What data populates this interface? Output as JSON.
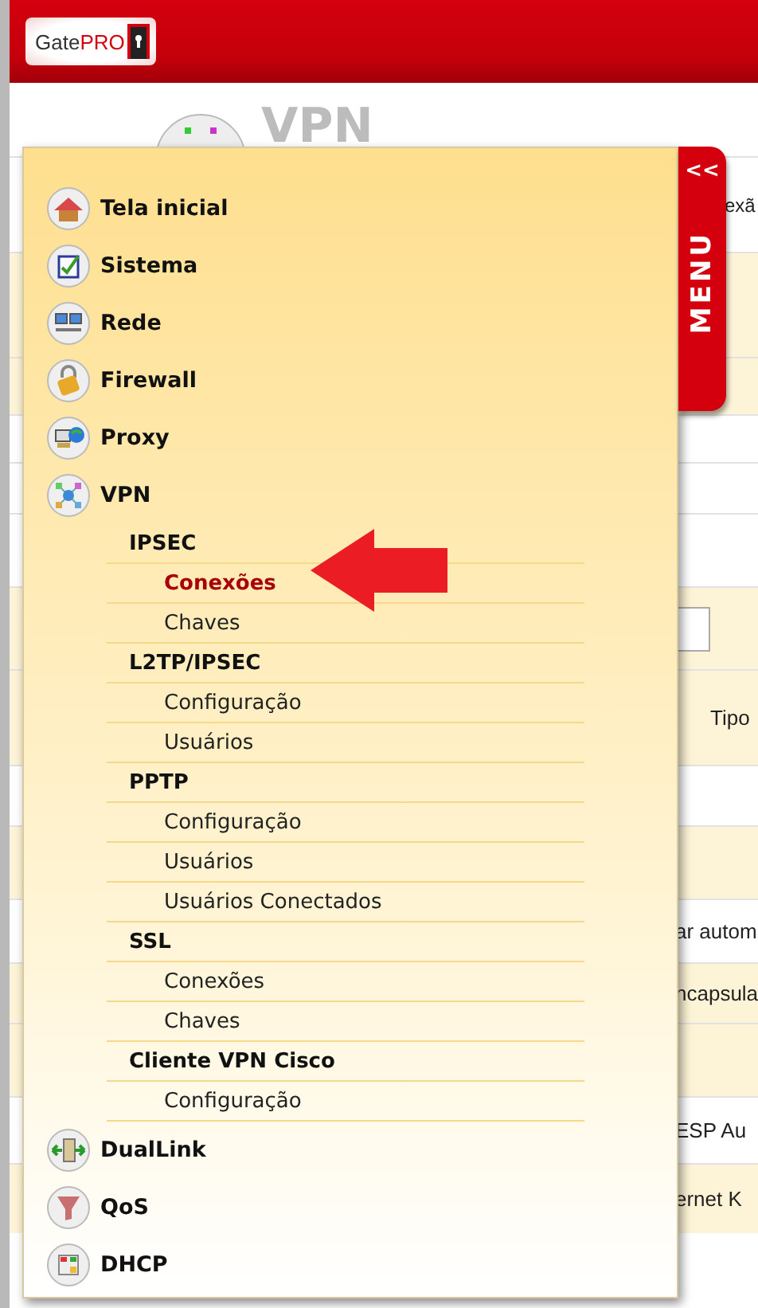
{
  "header": {
    "logo": [
      "Gate",
      "PRO"
    ]
  },
  "page_title": "VPN",
  "menu_tab": {
    "collapse": "<<",
    "label": "MENU"
  },
  "menu": [
    {
      "label": "Tela inicial"
    },
    {
      "label": "Sistema"
    },
    {
      "label": "Rede"
    },
    {
      "label": "Firewall"
    },
    {
      "label": "Proxy"
    },
    {
      "label": "VPN",
      "children": [
        {
          "label": "IPSEC",
          "children": [
            {
              "label": "Conexões",
              "selected": true
            },
            {
              "label": "Chaves",
              "selected": false
            }
          ]
        },
        {
          "label": "L2TP/IPSEC",
          "children": [
            {
              "label": "Configuração",
              "selected": false
            },
            {
              "label": "Usuários",
              "selected": false
            }
          ]
        },
        {
          "label": "PPTP",
          "children": [
            {
              "label": "Configuração",
              "selected": false
            },
            {
              "label": "Usuários",
              "selected": false
            },
            {
              "label": "Usuários Conectados",
              "selected": false
            }
          ]
        },
        {
          "label": "SSL",
          "children": [
            {
              "label": "Conexões",
              "selected": false
            },
            {
              "label": "Chaves",
              "selected": false
            }
          ]
        },
        {
          "label": "Cliente VPN Cisco",
          "children": [
            {
              "label": "Configuração",
              "selected": false
            }
          ]
        }
      ]
    },
    {
      "label": "DualLink"
    },
    {
      "label": "QoS"
    },
    {
      "label": "DHCP"
    }
  ],
  "background_texts": [
    "exã",
    "Tipo",
    "ar autom",
    "ncapsula",
    "ESP Au",
    "ernet K"
  ]
}
